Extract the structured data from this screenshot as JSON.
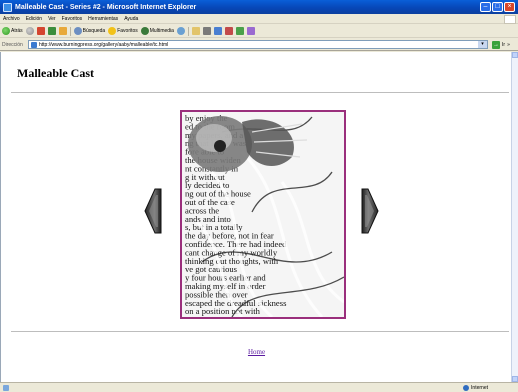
{
  "window": {
    "title": "Malleable Cast - Series #2 - Microsoft Internet Explorer"
  },
  "menu": [
    "Archivo",
    "Edición",
    "Ver",
    "Favoritos",
    "Herramientas",
    "Ayuda"
  ],
  "toolbar": {
    "back_label": "Atrás",
    "search_label": "Búsqueda",
    "favorites_label": "Favoritos",
    "media_label": "Multimedia"
  },
  "address": {
    "label": "Dirección",
    "url": "http://www.burningpress.org/gallery/aaby/malleable/tc.html",
    "go_label": "Ir"
  },
  "page": {
    "title": "Malleable Cast",
    "home_link": "Home"
  },
  "artwork_text": [
    "by enjoy the",
    "ed to the room",
    "my papers, and a",
    "ng that I now was",
    "fore able to",
    "the house widen",
    "nt constantly in",
    "g it without",
    "ly decided to",
    "ng out of the house",
    "out of the case",
    "across the",
    "ands and into",
    "s, but in a totally",
    "the day before, not in fear",
    "confidence. There had indeed",
    "cant change of my worldly",
    "thinking out thoughts, with",
    "ve got cautious",
    "y four hours earlier and",
    "making myself in order",
    "possible then over",
    "escaped the dreadful sickness",
    "on a position not with"
  ],
  "status": {
    "zone": "Internet"
  },
  "colors": {
    "title_bar": "#0747b8",
    "artwork_border": "#9a2f7c",
    "link": "#5a1aa0"
  }
}
